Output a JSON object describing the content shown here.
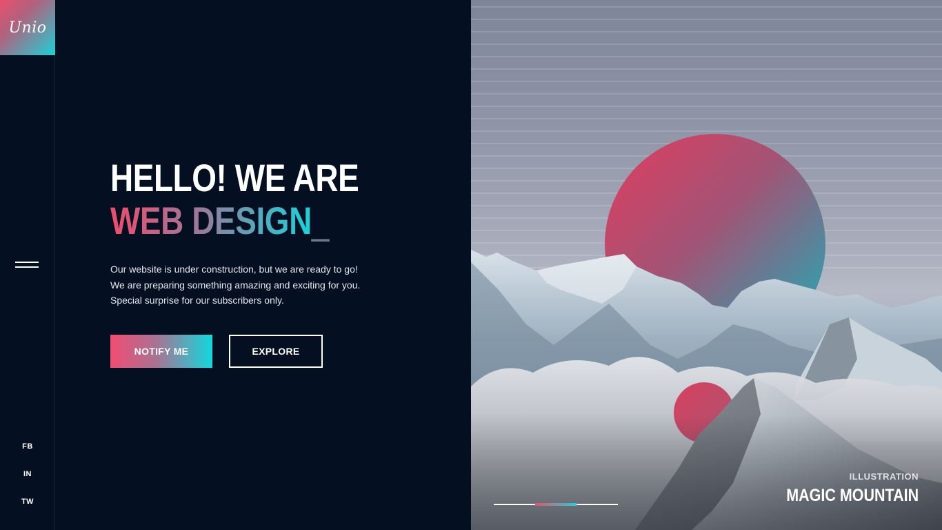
{
  "brand": {
    "logo_text": "Unio"
  },
  "sidebar": {
    "menu_icon": "hamburger-icon",
    "social": [
      "FB",
      "IN",
      "TW"
    ]
  },
  "hero": {
    "line1": "HELLO! WE ARE",
    "line2": "WEB DESIGN",
    "cursor": "_",
    "description": [
      "Our website is under construction, but we are ready to go!",
      "We are preparing something amazing and exciting for you.",
      "Special surprise for our subscribers only."
    ]
  },
  "buttons": {
    "notify": "NOTIFY ME",
    "explore": "EXPLORE"
  },
  "illustration": {
    "subtitle": "ILLUSTRATION",
    "title": "MAGIC MOUNTAIN",
    "slider_total": 3,
    "slider_active_index": 1
  },
  "colors": {
    "background": "#050f22",
    "accent_pink": "#ee4c6b",
    "accent_cyan": "#17d3db",
    "text": "#ffffff"
  }
}
